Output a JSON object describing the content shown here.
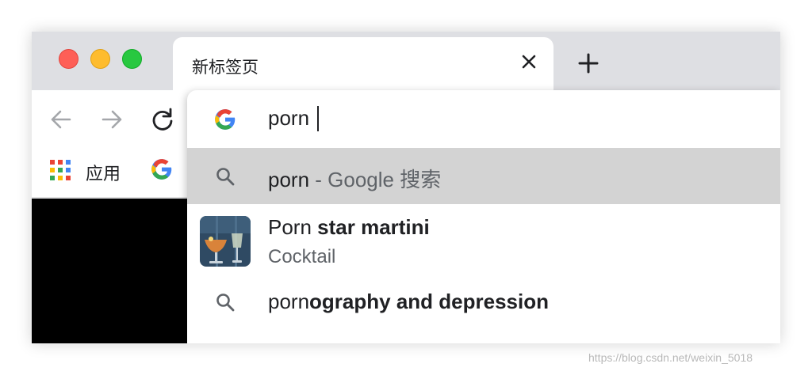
{
  "window": {
    "tab": {
      "title": "新标签页",
      "close_icon": "close-icon"
    },
    "new_tab_icon": "plus-icon"
  },
  "toolbar": {
    "back_icon": "arrow-left-icon",
    "forward_icon": "arrow-right-icon",
    "reload_icon": "reload-icon"
  },
  "bookmarks": {
    "apps_label": "应用",
    "items": [
      {
        "icon": "google-icon"
      }
    ]
  },
  "omnibox": {
    "input_value": "porn",
    "suggestions": [
      {
        "icon": "search-icon",
        "text": "porn",
        "suffix": " - Google 搜索"
      },
      {
        "icon": "cocktail-thumbnail",
        "text_plain": "Porn ",
        "text_bold": "star martini",
        "subtitle": "Cocktail"
      },
      {
        "icon": "search-icon",
        "text_plain": "porn",
        "text_bold": "ography and depression"
      }
    ]
  },
  "watermark": "https://blog.csdn.net/weixin_5018",
  "colors": {
    "close": "#fe5f57",
    "minimize": "#febc2e",
    "maximize": "#28c840",
    "selected_row": "#d3d3d3",
    "titlebar": "#dedfe3"
  }
}
